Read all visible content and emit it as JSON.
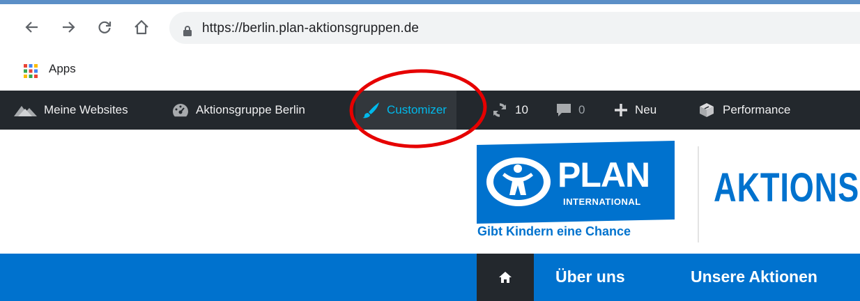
{
  "browser": {
    "url": "https://berlin.plan-aktionsgruppen.de",
    "bookmarks": [
      {
        "label": "Apps"
      }
    ]
  },
  "admin_bar": {
    "items": [
      {
        "label": "Meine Websites",
        "icon": "my-sites-icon"
      },
      {
        "label": "Aktionsgruppe Berlin",
        "icon": "dashboard-icon"
      },
      {
        "label": "Customizer",
        "icon": "paintbrush-icon",
        "active": true
      },
      {
        "label": "10",
        "icon": "updates-icon"
      },
      {
        "label": "0",
        "icon": "comments-icon"
      },
      {
        "label": "Neu",
        "icon": "plus-icon"
      },
      {
        "label": "Performance",
        "icon": "performance-icon"
      }
    ]
  },
  "site": {
    "logo": {
      "wordmark": "PLAN",
      "subtitle": "INTERNATIONAL",
      "tagline": "Gibt Kindern eine Chance"
    },
    "group_title": "AKTIONS"
  },
  "nav": {
    "items": [
      {
        "label": "Über uns"
      },
      {
        "label": "Unsere Aktionen"
      }
    ]
  },
  "colors": {
    "brand_blue": "#0072ce",
    "admin_bar_bg": "#23282d",
    "customizer_accent": "#00b9eb",
    "annotation_red": "#e60000"
  }
}
